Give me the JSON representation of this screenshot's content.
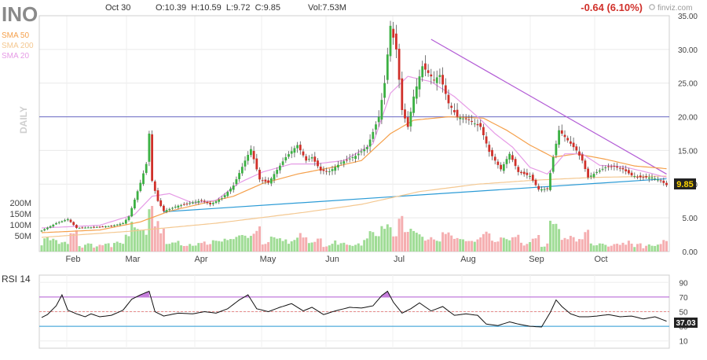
{
  "header": {
    "ticker": "INO",
    "date": "Oct 30",
    "ohlc": "O:10.39  H:10.59  L:9.72  C:9.85",
    "volume": "Vol:7.53M",
    "change": "-0.64 (6.10%)",
    "brand": "finviz.com"
  },
  "legend": [
    {
      "label": "SMA 50",
      "color": "#f5a04b"
    },
    {
      "label": "SMA 200",
      "color": "#f4c891"
    },
    {
      "label": "SMA 20",
      "color": "#e69be6"
    }
  ],
  "period_label": "DAILY",
  "last_price_label": "9.85",
  "rsi_label": "RSI 14",
  "rsi_value_label": "37.03",
  "colors": {
    "up": "#3cb043",
    "down": "#d0302a",
    "vol_up": "#9fdc95",
    "vol_down": "#f5aeb0",
    "sma20": "#e69be6",
    "sma50": "#f5a04b",
    "sma200": "#f4c891",
    "trend_down": "#b35dd6",
    "trend_up": "#2b9bd6",
    "resistance": "#6b6bc4"
  },
  "chart_data": [
    {
      "type": "candlestick",
      "x_months": [
        "Feb",
        "Mar",
        "Apr",
        "May",
        "Jun",
        "Jul",
        "Aug",
        "Sep",
        "Oct"
      ],
      "ylim": [
        0,
        35
      ],
      "y_ticks": [
        "35.00",
        "30.00",
        "25.00",
        "20.00",
        "15.00",
        "10.00",
        "5.00",
        "0.00"
      ],
      "volume_ticks": [
        "200M",
        "150M",
        "100M",
        "50M"
      ],
      "horizontal_level": 20,
      "trendlines": [
        {
          "name": "down",
          "from": [
            134,
            31.5
          ],
          "to": [
            215,
            11.5
          ]
        },
        {
          "name": "up",
          "from": [
            42,
            5.9
          ],
          "to": [
            215,
            10.8
          ]
        }
      ],
      "anchors": [
        [
          0,
          3.1
        ],
        [
          5,
          4.2
        ],
        [
          9,
          4.8
        ],
        [
          12,
          3.5
        ],
        [
          18,
          3.6
        ],
        [
          24,
          3.8
        ],
        [
          28,
          4.2
        ],
        [
          30,
          5.2
        ],
        [
          34,
          10.2
        ],
        [
          36,
          13.0
        ],
        [
          37,
          17.5
        ],
        [
          38,
          10.5
        ],
        [
          40,
          7.5
        ],
        [
          42,
          6.0
        ],
        [
          47,
          6.8
        ],
        [
          52,
          7.3
        ],
        [
          55,
          7.6
        ],
        [
          58,
          7.0
        ],
        [
          62,
          7.9
        ],
        [
          66,
          9.8
        ],
        [
          70,
          13.5
        ],
        [
          72,
          15.2
        ],
        [
          75,
          10.7
        ],
        [
          78,
          10.2
        ],
        [
          80,
          11.5
        ],
        [
          84,
          14.0
        ],
        [
          88,
          15.8
        ],
        [
          91,
          13.5
        ],
        [
          93,
          14.0
        ],
        [
          96,
          12.0
        ],
        [
          99,
          11.9
        ],
        [
          103,
          13.2
        ],
        [
          108,
          14.2
        ],
        [
          112,
          15.5
        ],
        [
          116,
          20.0
        ],
        [
          118,
          25.0
        ],
        [
          120,
          33.5
        ],
        [
          122,
          30.0
        ],
        [
          124,
          21.0
        ],
        [
          126,
          18.5
        ],
        [
          128,
          23.0
        ],
        [
          131,
          27.5
        ],
        [
          135,
          25.5
        ],
        [
          137,
          26.2
        ],
        [
          140,
          22.0
        ],
        [
          143,
          20.0
        ],
        [
          147,
          19.5
        ],
        [
          151,
          18.5
        ],
        [
          154,
          14.8
        ],
        [
          158,
          12.2
        ],
        [
          161,
          14.5
        ],
        [
          164,
          11.8
        ],
        [
          168,
          11.2
        ],
        [
          171,
          9.2
        ],
        [
          174,
          9.3
        ],
        [
          176,
          14.0
        ],
        [
          178,
          18.0
        ],
        [
          181,
          16.5
        ],
        [
          184,
          15.0
        ],
        [
          186,
          13.5
        ],
        [
          188,
          11.0
        ],
        [
          191,
          11.8
        ],
        [
          194,
          12.5
        ],
        [
          197,
          12.6
        ],
        [
          200,
          12.2
        ],
        [
          203,
          11.3
        ],
        [
          206,
          11.0
        ],
        [
          210,
          11.0
        ],
        [
          213,
          10.5
        ],
        [
          215,
          9.85
        ]
      ],
      "sma20_anchors": [
        [
          0,
          3.5
        ],
        [
          20,
          3.9
        ],
        [
          32,
          5.5
        ],
        [
          38,
          8.2
        ],
        [
          44,
          8.6
        ],
        [
          52,
          7.2
        ],
        [
          60,
          7.6
        ],
        [
          68,
          10.2
        ],
        [
          76,
          11.8
        ],
        [
          86,
          13.0
        ],
        [
          94,
          13.0
        ],
        [
          104,
          13.5
        ],
        [
          114,
          16.0
        ],
        [
          120,
          23.5
        ],
        [
          126,
          26.0
        ],
        [
          134,
          25.2
        ],
        [
          142,
          23.0
        ],
        [
          150,
          20.0
        ],
        [
          156,
          17.5
        ],
        [
          162,
          15.5
        ],
        [
          168,
          12.5
        ],
        [
          174,
          11.5
        ],
        [
          180,
          14.5
        ],
        [
          186,
          14.5
        ],
        [
          192,
          12.8
        ],
        [
          200,
          12.6
        ],
        [
          208,
          11.8
        ],
        [
          215,
          11.0
        ]
      ],
      "sma50_anchors": [
        [
          0,
          2.8
        ],
        [
          20,
          3.2
        ],
        [
          34,
          4.4
        ],
        [
          44,
          6.0
        ],
        [
          56,
          7.2
        ],
        [
          66,
          8.2
        ],
        [
          76,
          10.1
        ],
        [
          88,
          11.5
        ],
        [
          100,
          12.5
        ],
        [
          110,
          13.5
        ],
        [
          120,
          17.5
        ],
        [
          128,
          19.5
        ],
        [
          140,
          20.0
        ],
        [
          152,
          19.8
        ],
        [
          160,
          18.0
        ],
        [
          168,
          15.8
        ],
        [
          176,
          14.0
        ],
        [
          184,
          14.5
        ],
        [
          194,
          13.7
        ],
        [
          204,
          12.7
        ],
        [
          215,
          12.3
        ]
      ],
      "sma200_anchors": [
        [
          0,
          2.1
        ],
        [
          30,
          3.0
        ],
        [
          60,
          4.2
        ],
        [
          90,
          5.8
        ],
        [
          110,
          7.0
        ],
        [
          130,
          8.9
        ],
        [
          150,
          10.0
        ],
        [
          170,
          10.6
        ],
        [
          190,
          11.0
        ],
        [
          215,
          11.2
        ]
      ],
      "rsi_ylim": [
        0,
        100
      ],
      "rsi_ticks": [
        90,
        70,
        50,
        30,
        10
      ],
      "rsi_levels": [
        70,
        50,
        30
      ],
      "rsi_anchors": [
        [
          0,
          42
        ],
        [
          2,
          46
        ],
        [
          5,
          58
        ],
        [
          7,
          73
        ],
        [
          9,
          52
        ],
        [
          12,
          47
        ],
        [
          15,
          43
        ],
        [
          17,
          47
        ],
        [
          20,
          43
        ],
        [
          24,
          45
        ],
        [
          28,
          52
        ],
        [
          31,
          67
        ],
        [
          34,
          73
        ],
        [
          37,
          78
        ],
        [
          39,
          50
        ],
        [
          42,
          44
        ],
        [
          47,
          48
        ],
        [
          52,
          47
        ],
        [
          56,
          50
        ],
        [
          60,
          48
        ],
        [
          64,
          54
        ],
        [
          68,
          66
        ],
        [
          71,
          73
        ],
        [
          74,
          54
        ],
        [
          78,
          50
        ],
        [
          82,
          56
        ],
        [
          86,
          61
        ],
        [
          90,
          51
        ],
        [
          93,
          56
        ],
        [
          97,
          46
        ],
        [
          101,
          51
        ],
        [
          106,
          56
        ],
        [
          110,
          55
        ],
        [
          114,
          58
        ],
        [
          117,
          72
        ],
        [
          119,
          78
        ],
        [
          121,
          63
        ],
        [
          124,
          48
        ],
        [
          127,
          54
        ],
        [
          130,
          62
        ],
        [
          134,
          51
        ],
        [
          138,
          57
        ],
        [
          142,
          45
        ],
        [
          146,
          47
        ],
        [
          150,
          45
        ],
        [
          153,
          33
        ],
        [
          157,
          31
        ],
        [
          161,
          36
        ],
        [
          164,
          33
        ],
        [
          168,
          30
        ],
        [
          172,
          29
        ],
        [
          175,
          49
        ],
        [
          177,
          66
        ],
        [
          179,
          57
        ],
        [
          182,
          47
        ],
        [
          185,
          43
        ],
        [
          188,
          43
        ],
        [
          191,
          44
        ],
        [
          195,
          46
        ],
        [
          199,
          43
        ],
        [
          203,
          44
        ],
        [
          207,
          40
        ],
        [
          211,
          43
        ],
        [
          215,
          37
        ]
      ]
    }
  ]
}
